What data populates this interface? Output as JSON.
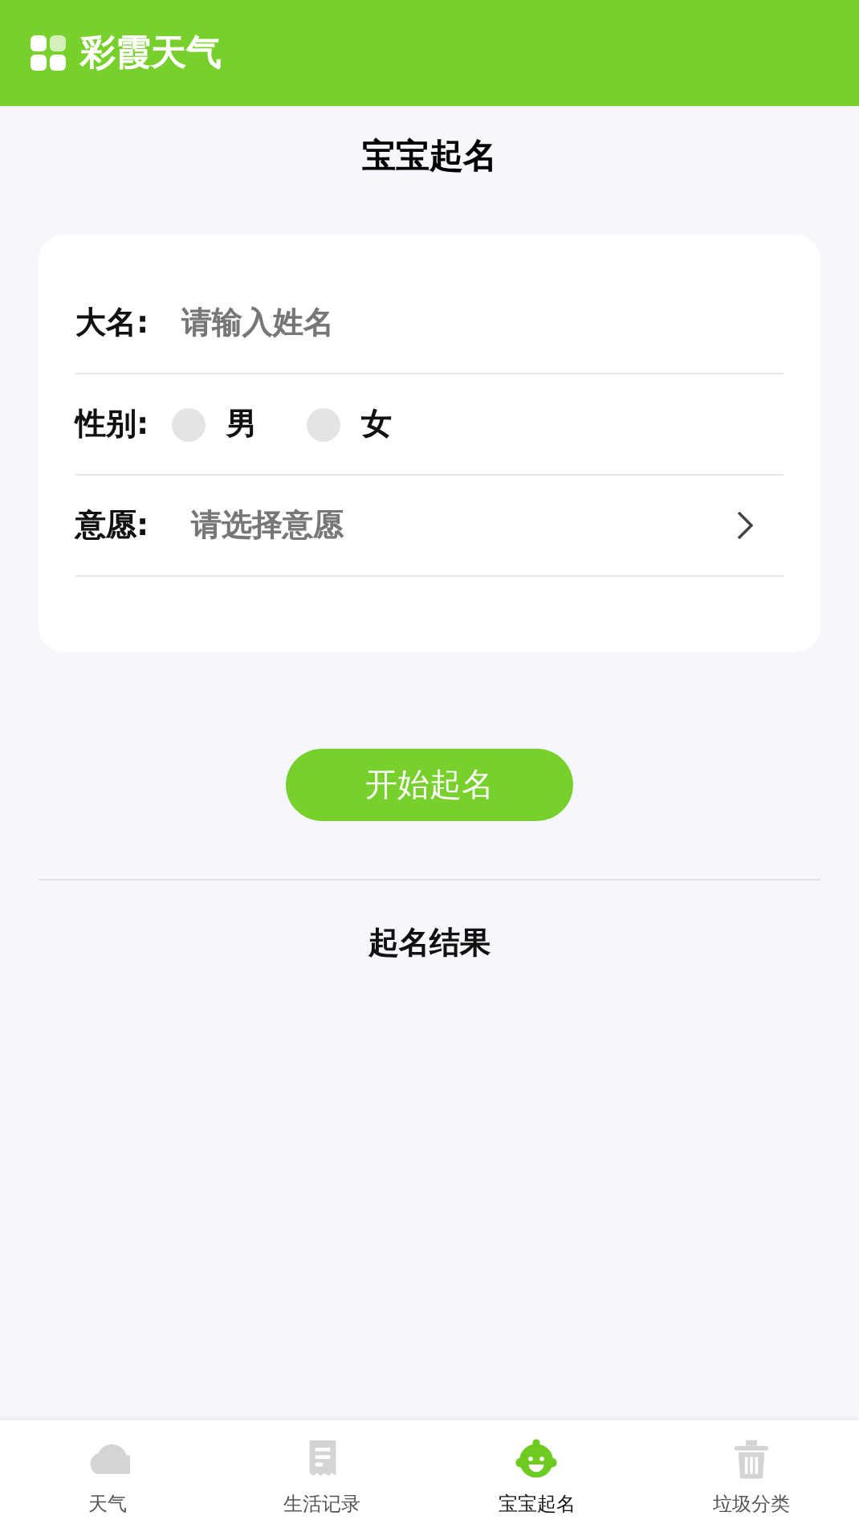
{
  "app_bar": {
    "title": "彩霞天气"
  },
  "page_title": "宝宝起名",
  "form": {
    "name": {
      "label": "大名:",
      "placeholder": "请输入姓名"
    },
    "gender": {
      "label": "性别:",
      "options": [
        {
          "label": "男",
          "selected": false
        },
        {
          "label": "女",
          "selected": false
        }
      ]
    },
    "wish": {
      "label": "意愿:",
      "placeholder": "请选择意愿"
    }
  },
  "start_button": "开始起名",
  "result_title": "起名结果",
  "tabs": [
    {
      "label": "天气",
      "kind": "cloud",
      "selected": false
    },
    {
      "label": "生活记录",
      "kind": "receipt",
      "selected": false
    },
    {
      "label": "宝宝起名",
      "kind": "baby",
      "selected": true
    },
    {
      "label": "垃圾分类",
      "kind": "trash",
      "selected": false
    }
  ]
}
